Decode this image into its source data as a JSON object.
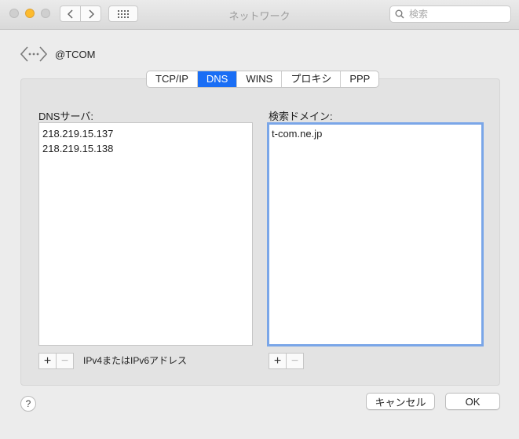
{
  "window": {
    "title": "ネットワーク",
    "search_placeholder": "検索"
  },
  "interface": {
    "name": "@TCOM"
  },
  "tabs": [
    {
      "label": "TCP/IP",
      "active": false
    },
    {
      "label": "DNS",
      "active": true
    },
    {
      "label": "WINS",
      "active": false
    },
    {
      "label": "プロキシ",
      "active": false
    },
    {
      "label": "PPP",
      "active": false
    }
  ],
  "dns": {
    "servers_label": "DNSサーバ:",
    "servers": [
      "218.219.15.137",
      "218.219.15.138"
    ],
    "servers_hint": "IPv4またはIPv6アドレス",
    "domains_label": "検索ドメイン:",
    "domains": [
      "t-com.ne.jp"
    ]
  },
  "controls": {
    "add_symbol": "+",
    "remove_symbol": "−",
    "help_symbol": "?"
  },
  "buttons": {
    "cancel": "キャンセル",
    "ok": "OK"
  },
  "colors": {
    "accent": "#1a6ef5",
    "focus_ring": "#7aa6e8",
    "minimize": "#fdbb2d"
  }
}
